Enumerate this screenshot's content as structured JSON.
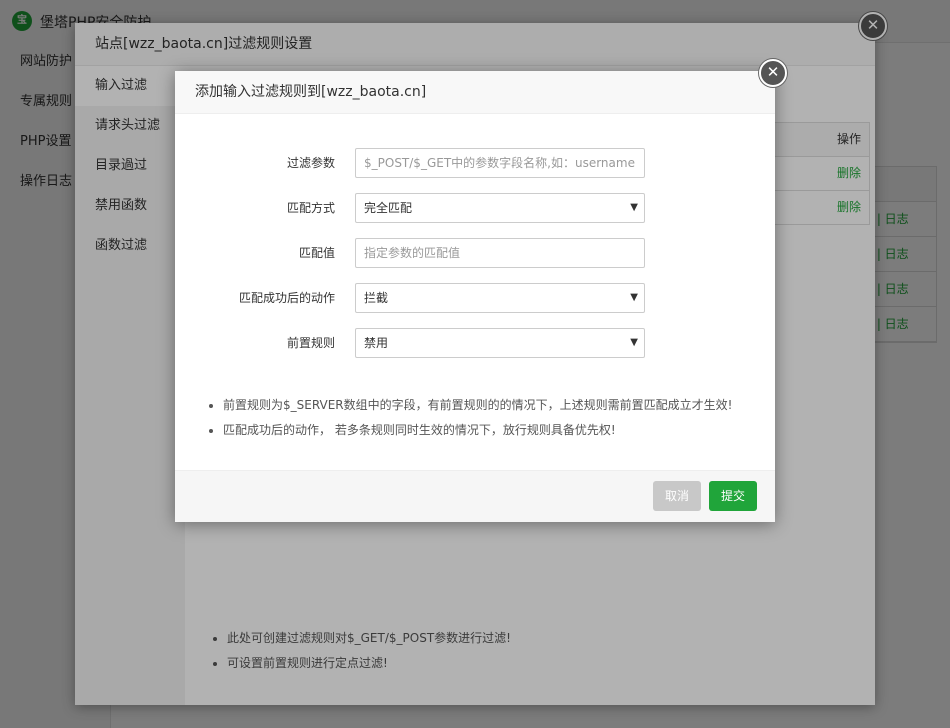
{
  "app": {
    "title": "堡塔PHP安全防护",
    "logo_text": "宝",
    "sidebar": [
      "网站防护",
      "专属规则",
      "PHP设置",
      "操作日志"
    ],
    "bg_table": {
      "head": "",
      "rows": [
        "删 | 日志",
        "删 | 日志",
        "删 | 日志",
        "删 | 日志"
      ]
    }
  },
  "window": {
    "title": "站点[wzz_baota.cn]过滤规则设置",
    "tabs": [
      "输入过滤",
      "请求头过滤",
      "目录過过",
      "禁用函数",
      "函数过滤"
    ],
    "table": {
      "op_header": "操作",
      "row_action": "删除"
    },
    "tips": [
      "此处可创建过滤规则对$_GET/$_POST参数进行过滤!",
      "可设置前置规则进行定点过滤!"
    ]
  },
  "dialog": {
    "title": "添加输入过滤规则到[wzz_baota.cn]",
    "fields": {
      "param": {
        "label": "过滤参数",
        "placeholder": "$_POST/$_GET中的参数字段名称,如：username"
      },
      "match_mode": {
        "label": "匹配方式",
        "value": "完全匹配"
      },
      "match_value": {
        "label": "匹配值",
        "placeholder": "指定参数的匹配值"
      },
      "action": {
        "label": "匹配成功后的动作",
        "value": "拦截"
      },
      "pre_rule": {
        "label": "前置规则",
        "value": "禁用"
      }
    },
    "notes": [
      "前置规则为$_SERVER数组中的字段，有前置规则的的情况下，上述规则需前置匹配成立才生效!",
      "匹配成功后的动作， 若多条规则同时生效的情况下，放行规则具备优先权!"
    ],
    "cancel_label": "取消",
    "submit_label": "提交"
  },
  "icons": {
    "close": "close-icon",
    "chevron": "chevron-down-icon"
  },
  "colors": {
    "accent": "#20a53a",
    "cancel": "#c8c8c8"
  }
}
